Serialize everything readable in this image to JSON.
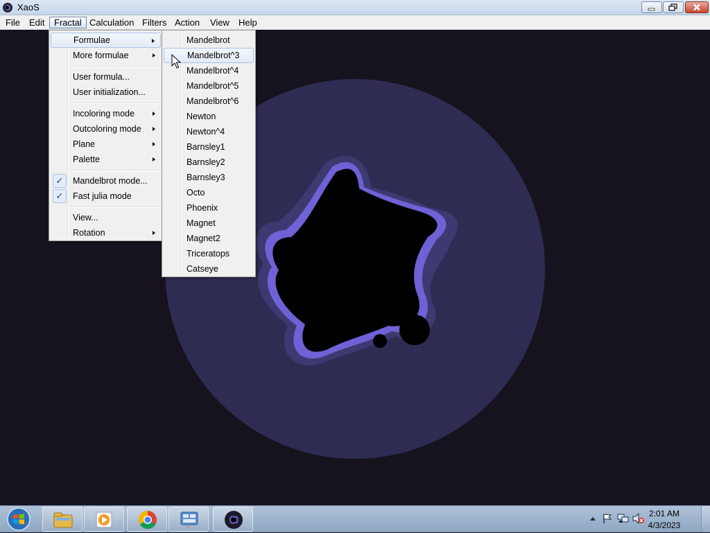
{
  "window": {
    "title": "XaoS",
    "icons": {
      "app": "xaos-app-icon",
      "minimize": "minimize-icon",
      "maximize": "restore-icon",
      "close": "close-icon"
    }
  },
  "menubar": {
    "items": [
      "File",
      "Edit",
      "Fractal",
      "Calculation",
      "Filters",
      "Action",
      "View",
      "Help"
    ],
    "active": "Fractal"
  },
  "fractal_menu": {
    "items": [
      {
        "label": "Formulae",
        "submenu": true,
        "highlighted": true
      },
      {
        "label": "More formulae",
        "submenu": true
      },
      {
        "label": "User formula..."
      },
      {
        "label": "User initialization..."
      },
      {
        "label": "Incoloring mode",
        "submenu": true
      },
      {
        "label": "Outcoloring mode",
        "submenu": true
      },
      {
        "label": "Plane",
        "submenu": true
      },
      {
        "label": "Palette",
        "submenu": true
      },
      {
        "label": "Mandelbrot mode...",
        "checked": true
      },
      {
        "label": "Fast julia mode",
        "checked": true
      },
      {
        "label": "View..."
      },
      {
        "label": "Rotation",
        "submenu": true
      }
    ],
    "check_glyph": "✓"
  },
  "formulae_submenu": {
    "items": [
      "Mandelbrot",
      "Mandelbrot^3",
      "Mandelbrot^4",
      "Mandelbrot^5",
      "Mandelbrot^6",
      "Newton",
      "Newton^4",
      "Barnsley1",
      "Barnsley2",
      "Barnsley3",
      "Octo",
      "Phoenix",
      "Magnet",
      "Magnet2",
      "Triceratops",
      "Catseye"
    ],
    "hovered": "Mandelbrot^3"
  },
  "taskbar": {
    "apps": [
      "windows-explorer-icon",
      "media-player-icon",
      "chrome-icon",
      "control-panel-icon",
      "xaos-app-icon"
    ],
    "tray_icons": [
      "show-hidden-icons-icon",
      "action-center-flag-icon",
      "network-icon",
      "volume-muted-icon"
    ],
    "clock": {
      "time": "2:01 AM",
      "date": "4/3/2023"
    }
  },
  "colors": {
    "background": "#16131f",
    "fractal_outer": "#2f2c54",
    "fractal_mid": "#3d3a72",
    "fractal_edge": "#6f62d6",
    "fractal_body": "#000000"
  }
}
